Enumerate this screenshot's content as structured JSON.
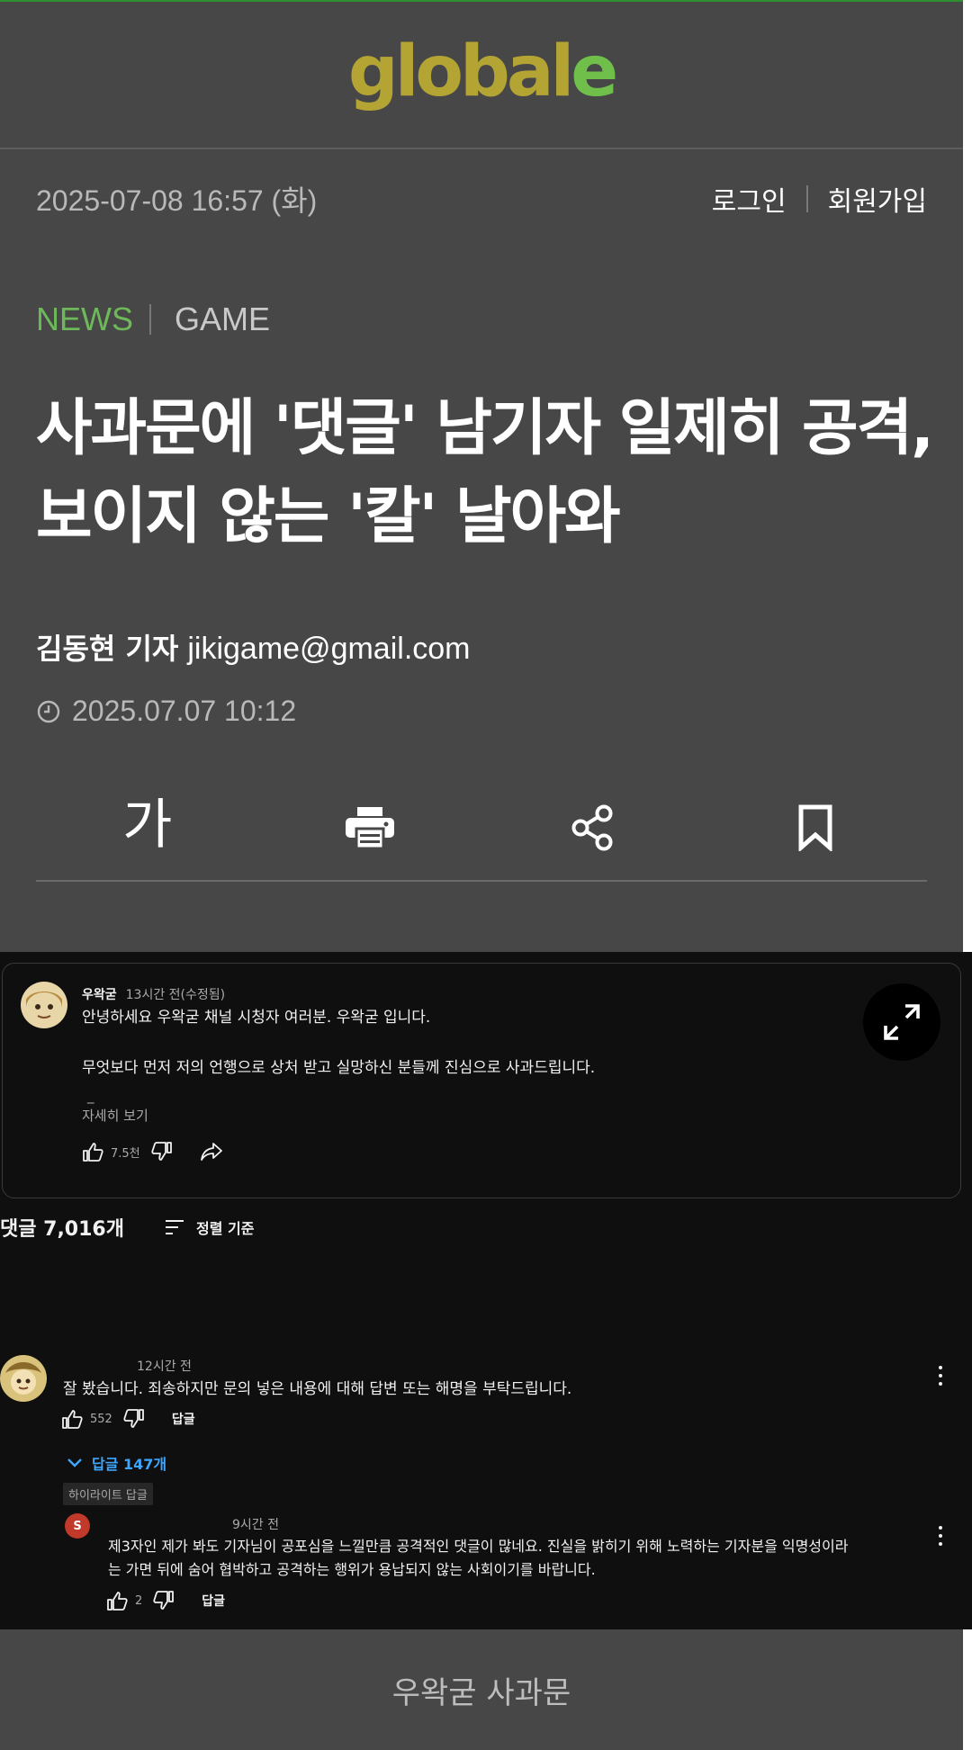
{
  "site": {
    "logo_main": "global",
    "logo_last": "e"
  },
  "header": {
    "date": "2025-07-08 16:57 (화)",
    "login": "로그인",
    "signup": "회원가입"
  },
  "category": {
    "primary": "NEWS",
    "secondary": "GAME"
  },
  "article": {
    "title": "사과문에 '댓글' 남기자 일제히 공격, 보이지 않는 '칼' 날아와",
    "author": "김동현 기자",
    "email": "jikigame@gmail.com",
    "published": "2025.07.07 10:12"
  },
  "toolbar": {
    "font_size_label": "가",
    "icons": [
      "print-icon",
      "share-icon",
      "bookmark-icon"
    ]
  },
  "youtube": {
    "pinned": {
      "author": "우왁굳",
      "time": "13시간 전(수정됨)",
      "line1": "안녕하세요 우왁굳 채널 시청자 여러분. 우왁굳 입니다.",
      "line2": "무엇보다 먼저 저의 언행으로 상처 받고 실망하신 분들께 진심으로 사과드립니다.",
      "dash": "_",
      "more": "자세히 보기",
      "likes": "7.5천"
    },
    "comment_count": "댓글 7,016개",
    "sort_label": "정렬 기준",
    "comment1": {
      "time": "12시간 전",
      "text": "잘 봤습니다. 죄송하지만 문의 넣은 내용에 대해 답변 또는 해명을 부탁드립니다.",
      "likes": "552",
      "reply": "답글",
      "replies_toggle": "답글 147개"
    },
    "highlight_badge": "하이라이트 답글",
    "reply1": {
      "avatar_letter": "S",
      "time": "9시간 전",
      "line1": "제3자인 제가 봐도 기자님이 공포심을 느낄만큼 공격적인 댓글이 많네요. 진실을 밝히기 위해 노력하는 기자분을 익명성이라",
      "line2": "는 가면 뒤에 숨어 협박하고 공격하는 행위가 용납되지 않는 사회이기를 바랍니다.",
      "likes": "2",
      "reply": "답글"
    }
  },
  "caption": "우왁굳 사과문",
  "colors": {
    "article_bg": "#474747",
    "logo_olive": "#b4a434",
    "logo_green": "#6fbf4a",
    "news_green": "#6db95a",
    "youtube_bg": "#0f0f0f",
    "link_blue": "#3ea6ff"
  }
}
